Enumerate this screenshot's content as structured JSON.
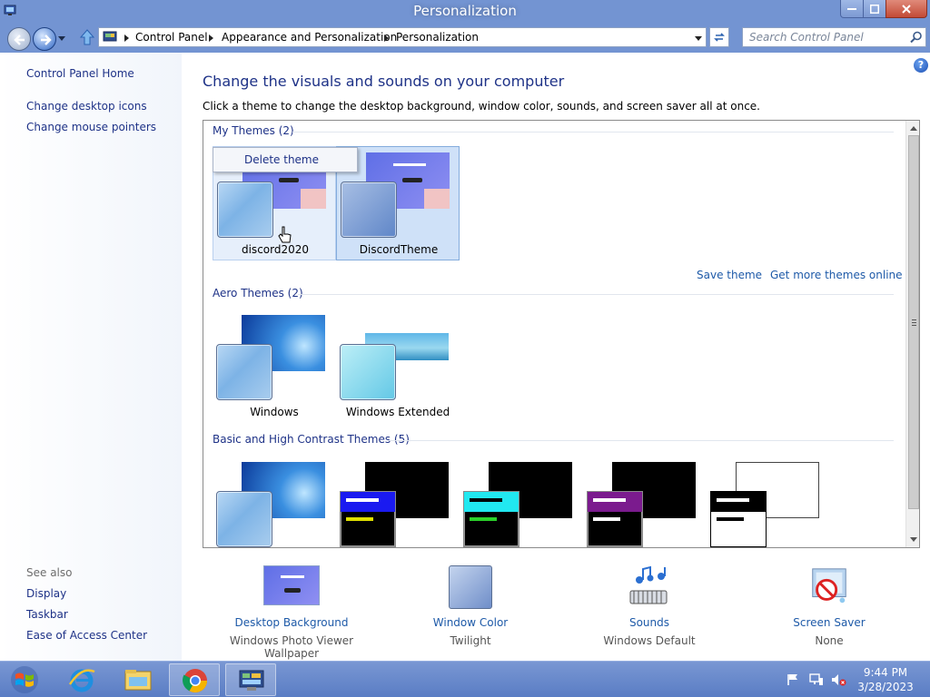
{
  "window": {
    "title": "Personalization",
    "icons": {
      "app": "personalization-icon",
      "minimize": "minimize-icon",
      "maximize": "maximize-icon",
      "close": "close-icon"
    }
  },
  "address": {
    "breadcrumbs": [
      "Control Panel",
      "Appearance and Personalization",
      "Personalization"
    ],
    "search_placeholder": "Search Control Panel"
  },
  "sidebar": {
    "home": "Control Panel Home",
    "links": [
      "Change desktop icons",
      "Change mouse pointers"
    ],
    "see_also_label": "See also",
    "see_also": [
      "Display",
      "Taskbar",
      "Ease of Access Center"
    ]
  },
  "main": {
    "heading": "Change the visuals and sounds on your computer",
    "subheading": "Click a theme to change the desktop background, window color, sounds, and screen saver all at once.",
    "groups": {
      "my_themes": "My Themes (2)",
      "aero_themes": "Aero Themes (2)",
      "basic_themes": "Basic and High Contrast Themes (5)"
    },
    "my_themes": [
      {
        "name": "discord2020",
        "state": "hover"
      },
      {
        "name": "DiscordTheme",
        "state": "selected"
      }
    ],
    "aero_themes": [
      {
        "name": "Windows"
      },
      {
        "name": "Windows Extended"
      }
    ],
    "context_menu": "Delete theme",
    "save_theme": "Save theme",
    "get_more": "Get more themes online"
  },
  "options": [
    {
      "title": "Desktop Background",
      "value": "Windows Photo Viewer Wallpaper",
      "icon": "desktop-background-icon"
    },
    {
      "title": "Window Color",
      "value": "Twilight",
      "icon": "window-color-icon"
    },
    {
      "title": "Sounds",
      "value": "Windows Default",
      "icon": "sounds-icon"
    },
    {
      "title": "Screen Saver",
      "value": "None",
      "icon": "screen-saver-icon"
    }
  ],
  "taskbar": {
    "apps": [
      "internet-explorer-icon",
      "file-explorer-icon",
      "chrome-icon",
      "control-panel-icon"
    ],
    "time": "9:44 PM",
    "date": "3/28/2023"
  },
  "colors": {
    "link": "#1e3287",
    "accent_frame": "#7394d2",
    "selection": "#cfe1f8"
  }
}
